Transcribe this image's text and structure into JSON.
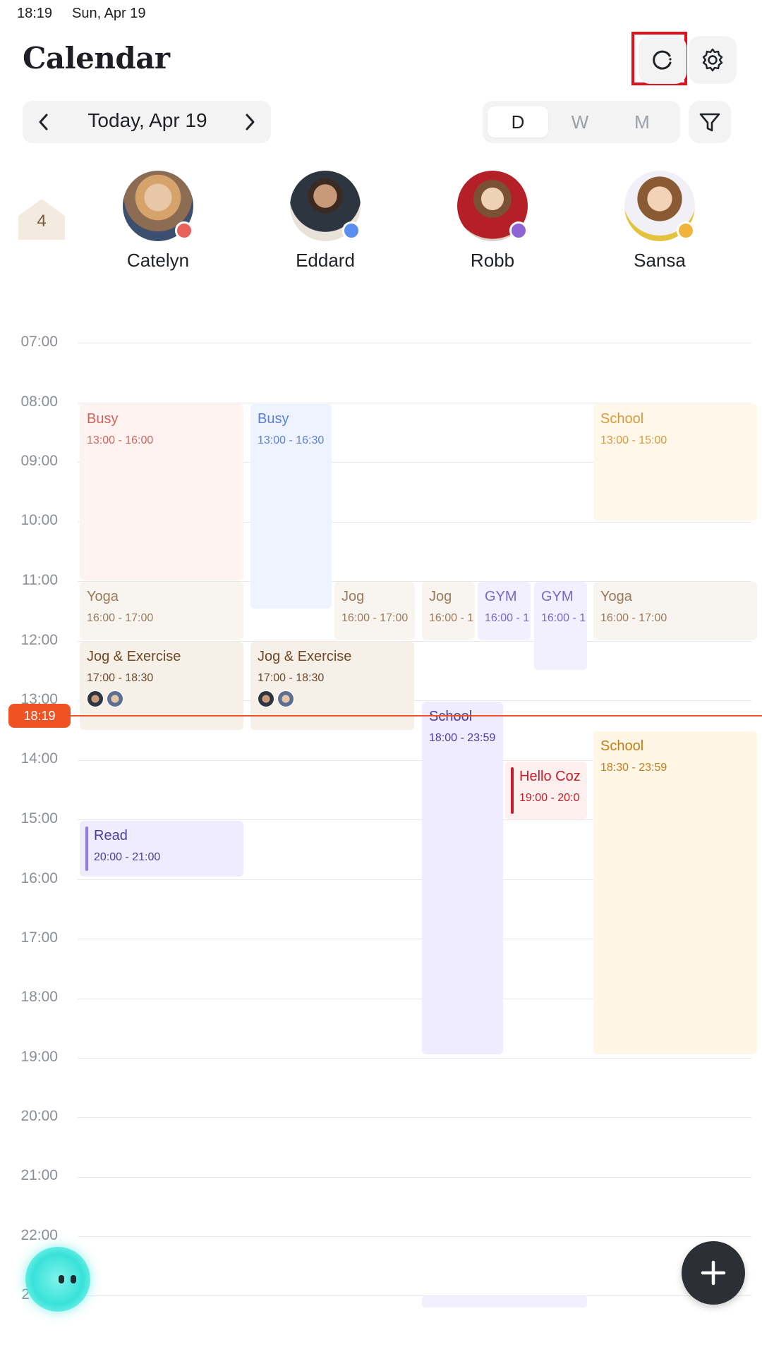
{
  "status_bar": {
    "time": "18:19",
    "date": "Sun, Apr 19"
  },
  "header": {
    "title": "Calendar"
  },
  "date_nav": {
    "label": "Today, Apr 19"
  },
  "view_switch": {
    "day": "D",
    "week": "W",
    "month": "M",
    "selected": "D"
  },
  "household": {
    "count": "4"
  },
  "members": [
    {
      "name": "Catelyn",
      "dot_color": "#e8615a"
    },
    {
      "name": "Eddard",
      "dot_color": "#5b8df0"
    },
    {
      "name": "Robb",
      "dot_color": "#8e63d8"
    },
    {
      "name": "Sansa",
      "dot_color": "#f0b43a"
    }
  ],
  "hours": [
    "07:00",
    "08:00",
    "09:00",
    "10:00",
    "11:00",
    "12:00",
    "13:00",
    "14:00",
    "15:00",
    "16:00",
    "17:00",
    "18:00",
    "19:00",
    "20:00",
    "21:00",
    "22:00",
    "2"
  ],
  "events": {
    "catelyn_busy": {
      "title": "Busy",
      "time": "13:00 - 16:00"
    },
    "eddard_busy": {
      "title": "Busy",
      "time": "13:00 - 16:30"
    },
    "sansa_school_1": {
      "title": "School",
      "time": "13:00 - 15:00"
    },
    "catelyn_yoga": {
      "title": "Yoga",
      "time": "16:00 - 17:00"
    },
    "eddard_jog": {
      "title": "Jog",
      "time": "16:00 - 17:00"
    },
    "robb_jog": {
      "title": "Jog",
      "time": "16:00 - 1"
    },
    "robb_gym_1": {
      "title": "GYM",
      "time": "16:00 - 1"
    },
    "robb_gym_2": {
      "title": "GYM",
      "time": "16:00 - 1"
    },
    "sansa_yoga": {
      "title": "Yoga",
      "time": "16:00 - 17:00"
    },
    "catelyn_jog_exercise": {
      "title": "Jog & Exercise",
      "time": "17:00 - 18:30"
    },
    "eddard_jog_exercise": {
      "title": "Jog & Exercise",
      "time": "17:00 - 18:30"
    },
    "robb_school": {
      "title": "School",
      "time": "18:00 - 23:59"
    },
    "sansa_school_2": {
      "title": "School",
      "time": "18:30 - 23:59"
    },
    "robb_hello": {
      "title": "Hello Coz",
      "time": "19:00 - 20:0"
    },
    "catelyn_read": {
      "title": "Read",
      "time": "20:00 - 21:00"
    }
  },
  "now_indicator": {
    "time": "18:19"
  },
  "colors": {
    "accent": "#f05223",
    "fab": "#2c3036"
  },
  "icons": {
    "refresh": "refresh-icon",
    "settings": "gear-icon",
    "filter": "filter-icon",
    "prev": "chevron-left-icon",
    "next": "chevron-right-icon",
    "add": "plus-icon",
    "home": "house-icon"
  }
}
